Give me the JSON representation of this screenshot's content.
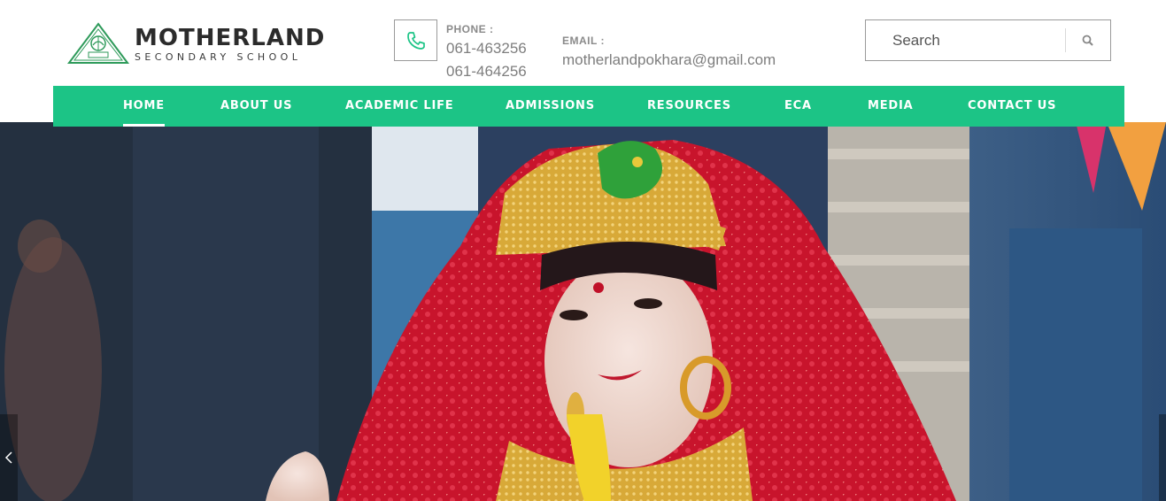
{
  "brand": {
    "name": "MOTHERLAND",
    "tagline": "SECONDARY SCHOOL",
    "emblem_text": "ESTD:2051"
  },
  "contact": {
    "phone_label": "PHONE :",
    "phone_1": "061-463256",
    "phone_2": "061-464256",
    "email_label": "EMAIL :",
    "email": "motherlandpokhara@gmail.com"
  },
  "search": {
    "placeholder": "Search",
    "icon": "search-icon"
  },
  "nav": {
    "items": [
      {
        "label": "HOME",
        "active": true
      },
      {
        "label": "ABOUT US"
      },
      {
        "label": "ACADEMIC LIFE"
      },
      {
        "label": "ADMISSIONS"
      },
      {
        "label": "RESOURCES"
      },
      {
        "label": "ECA"
      },
      {
        "label": "MEDIA"
      },
      {
        "label": "CONTACT US"
      }
    ]
  },
  "icons": {
    "phone": "phone-icon",
    "prev": "chevron-left-icon",
    "next": "chevron-right-icon"
  },
  "colors": {
    "accent": "#1cc486",
    "logo_green": "#2e9a5a"
  }
}
